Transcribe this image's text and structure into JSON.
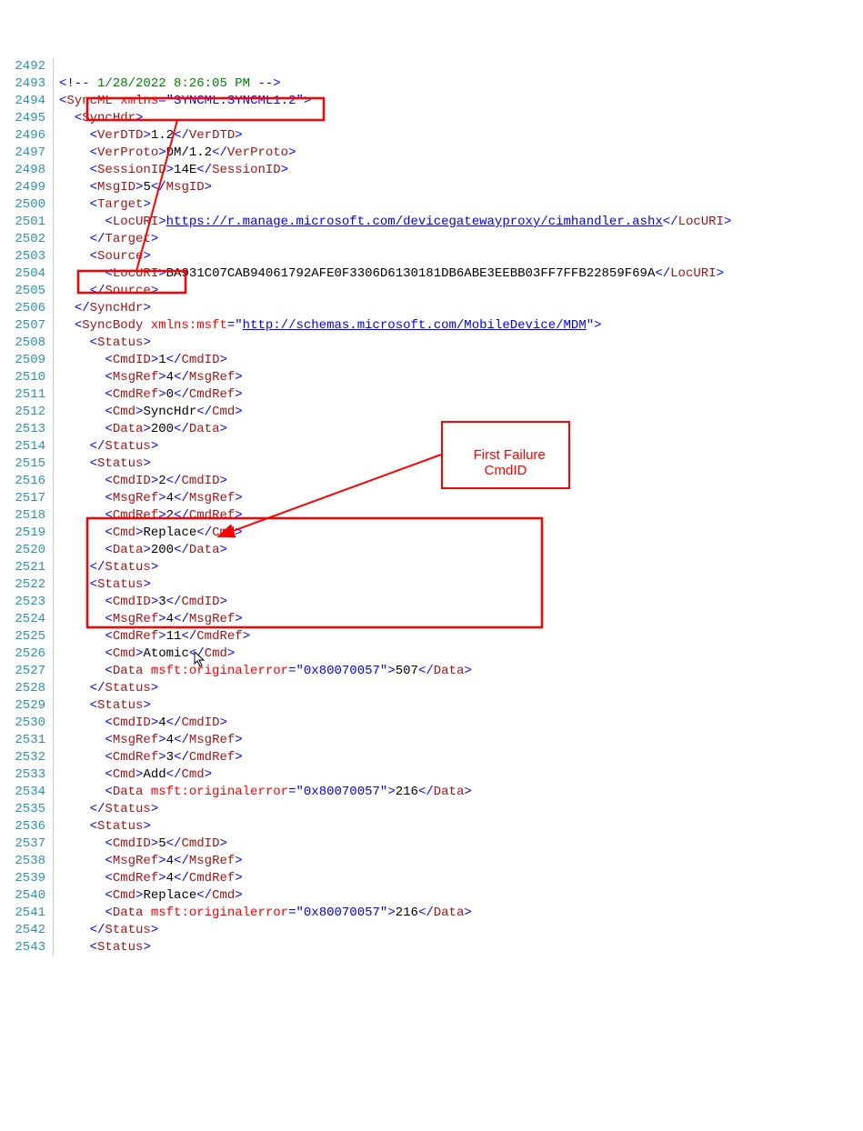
{
  "callout_label": "First Failure\nCmdID",
  "lines": [
    {
      "n": 2492,
      "html": ""
    },
    {
      "n": 2493,
      "html": "<span class='b'>&lt;!--</span> <span class='c'>1/28/2022 8:26:05 PM</span> <span class='b'>--&gt;</span>"
    },
    {
      "n": 2494,
      "html": "<span class='b'>&lt;</span><span class='t'>SyncML</span> <span class='a'>xmlns</span><span class='b'>=</span><span class='v'>\"SYNCML:SYNCML1.2\"</span><span class='b'>&gt;</span>"
    },
    {
      "n": 2495,
      "html": "  <span class='b'>&lt;</span><span class='t'>SyncHdr</span><span class='b'>&gt;</span>"
    },
    {
      "n": 2496,
      "html": "    <span class='b'>&lt;</span><span class='t'>VerDTD</span><span class='b'>&gt;</span><span class='k'>1.2</span><span class='b'>&lt;/</span><span class='t'>VerDTD</span><span class='b'>&gt;</span>"
    },
    {
      "n": 2497,
      "html": "    <span class='b'>&lt;</span><span class='t'>VerProto</span><span class='b'>&gt;</span><span class='k'>DM/1.2</span><span class='b'>&lt;/</span><span class='t'>VerProto</span><span class='b'>&gt;</span>"
    },
    {
      "n": 2498,
      "html": "    <span class='b'>&lt;</span><span class='t'>SessionID</span><span class='b'>&gt;</span><span class='k'>14E</span><span class='b'>&lt;/</span><span class='t'>SessionID</span><span class='b'>&gt;</span>"
    },
    {
      "n": 2499,
      "html": "    <span class='b'>&lt;</span><span class='t'>MsgID</span><span class='b'>&gt;</span><span class='k'>5</span><span class='b'>&lt;/</span><span class='t'>MsgID</span><span class='b'>&gt;</span>"
    },
    {
      "n": 2500,
      "html": "    <span class='b'>&lt;</span><span class='t'>Target</span><span class='b'>&gt;</span>"
    },
    {
      "n": 2501,
      "html": "      <span class='b'>&lt;</span><span class='t'>LocURI</span><span class='b'>&gt;</span><span class='u'>https://r.manage.microsoft.com/devicegatewayproxy/cimhandler.ashx</span><span class='b'>&lt;/</span><span class='t'>LocURI</span><span class='b'>&gt;</span>"
    },
    {
      "n": 2502,
      "html": "    <span class='b'>&lt;/</span><span class='t'>Target</span><span class='b'>&gt;</span>"
    },
    {
      "n": 2503,
      "html": "    <span class='b'>&lt;</span><span class='t'>Source</span><span class='b'>&gt;</span>"
    },
    {
      "n": 2504,
      "html": "      <span class='b'>&lt;</span><span class='t'>LocURI</span><span class='b'>&gt;</span><span class='k'>BA931C07CAB94061792AFE0F3306D6130181DB6ABE3EEBB03FF7FFB22859F69A</span><span class='b'>&lt;/</span><span class='t'>LocURI</span><span class='b'>&gt;</span>"
    },
    {
      "n": 2505,
      "html": "    <span class='b'>&lt;/</span><span class='t'>Source</span><span class='b'>&gt;</span>"
    },
    {
      "n": 2506,
      "html": "  <span class='b'>&lt;/</span><span class='t'>SyncHdr</span><span class='b'>&gt;</span>"
    },
    {
      "n": 2507,
      "html": "  <span class='b'>&lt;</span><span class='t'>SyncBody</span> <span class='a'>xmlns:msft</span><span class='b'>=</span><span class='b'>\"</span><span class='u'>http://schemas.microsoft.com/MobileDevice/MDM</span><span class='b'>\"&gt;</span>"
    },
    {
      "n": 2508,
      "html": "    <span class='b'>&lt;</span><span class='t'>Status</span><span class='b'>&gt;</span>"
    },
    {
      "n": 2509,
      "html": "      <span class='b'>&lt;</span><span class='t'>CmdID</span><span class='b'>&gt;</span><span class='k'>1</span><span class='b'>&lt;/</span><span class='t'>CmdID</span><span class='b'>&gt;</span>"
    },
    {
      "n": 2510,
      "html": "      <span class='b'>&lt;</span><span class='t'>MsgRef</span><span class='b'>&gt;</span><span class='k'>4</span><span class='b'>&lt;/</span><span class='t'>MsgRef</span><span class='b'>&gt;</span>"
    },
    {
      "n": 2511,
      "html": "      <span class='b'>&lt;</span><span class='t'>CmdRef</span><span class='b'>&gt;</span><span class='k'>0</span><span class='b'>&lt;/</span><span class='t'>CmdRef</span><span class='b'>&gt;</span>"
    },
    {
      "n": 2512,
      "html": "      <span class='b'>&lt;</span><span class='t'>Cmd</span><span class='b'>&gt;</span><span class='k'>SyncHdr</span><span class='b'>&lt;/</span><span class='t'>Cmd</span><span class='b'>&gt;</span>"
    },
    {
      "n": 2513,
      "html": "      <span class='b'>&lt;</span><span class='t'>Data</span><span class='b'>&gt;</span><span class='k'>200</span><span class='b'>&lt;/</span><span class='t'>Data</span><span class='b'>&gt;</span>"
    },
    {
      "n": 2514,
      "html": "    <span class='b'>&lt;/</span><span class='t'>Status</span><span class='b'>&gt;</span>"
    },
    {
      "n": 2515,
      "html": "    <span class='b'>&lt;</span><span class='t'>Status</span><span class='b'>&gt;</span>"
    },
    {
      "n": 2516,
      "html": "      <span class='b'>&lt;</span><span class='t'>CmdID</span><span class='b'>&gt;</span><span class='k'>2</span><span class='b'>&lt;/</span><span class='t'>CmdID</span><span class='b'>&gt;</span>"
    },
    {
      "n": 2517,
      "html": "      <span class='b'>&lt;</span><span class='t'>MsgRef</span><span class='b'>&gt;</span><span class='k'>4</span><span class='b'>&lt;/</span><span class='t'>MsgRef</span><span class='b'>&gt;</span>"
    },
    {
      "n": 2518,
      "html": "      <span class='b'>&lt;</span><span class='t'>CmdRef</span><span class='b'>&gt;</span><span class='k'>2</span><span class='b'>&lt;/</span><span class='t'>CmdRef</span><span class='b'>&gt;</span>"
    },
    {
      "n": 2519,
      "html": "      <span class='b'>&lt;</span><span class='t'>Cmd</span><span class='b'>&gt;</span><span class='k'>Replace</span><span class='b'>&lt;/</span><span class='t'>Cmd</span><span class='b'>&gt;</span>"
    },
    {
      "n": 2520,
      "html": "      <span class='b'>&lt;</span><span class='t'>Data</span><span class='b'>&gt;</span><span class='k'>200</span><span class='b'>&lt;/</span><span class='t'>Data</span><span class='b'>&gt;</span>"
    },
    {
      "n": 2521,
      "html": "    <span class='b'>&lt;/</span><span class='t'>Status</span><span class='b'>&gt;</span>"
    },
    {
      "n": 2522,
      "html": "    <span class='b'>&lt;</span><span class='t'>Status</span><span class='b'>&gt;</span>"
    },
    {
      "n": 2523,
      "html": "      <span class='b'>&lt;</span><span class='t'>CmdID</span><span class='b'>&gt;</span><span class='k'>3</span><span class='b'>&lt;/</span><span class='t'>CmdID</span><span class='b'>&gt;</span>"
    },
    {
      "n": 2524,
      "html": "      <span class='b'>&lt;</span><span class='t'>MsgRef</span><span class='b'>&gt;</span><span class='k'>4</span><span class='b'>&lt;/</span><span class='t'>MsgRef</span><span class='b'>&gt;</span>"
    },
    {
      "n": 2525,
      "html": "      <span class='b'>&lt;</span><span class='t'>CmdRef</span><span class='b'>&gt;</span><span class='k'>11</span><span class='b'>&lt;/</span><span class='t'>CmdRef</span><span class='b'>&gt;</span>"
    },
    {
      "n": 2526,
      "html": "      <span class='b'>&lt;</span><span class='t'>Cmd</span><span class='b'>&gt;</span><span class='k'>Atomic</span><span class='b'>&lt;/</span><span class='t'>Cmd</span><span class='b'>&gt;</span>"
    },
    {
      "n": 2527,
      "html": "      <span class='b'>&lt;</span><span class='t'>Data</span> <span class='a'>msft:originalerror</span><span class='b'>=</span><span class='v'>\"0x80070057\"</span><span class='b'>&gt;</span><span class='k'>507</span><span class='b'>&lt;/</span><span class='t'>Data</span><span class='b'>&gt;</span>"
    },
    {
      "n": 2528,
      "html": "    <span class='b'>&lt;/</span><span class='t'>Status</span><span class='b'>&gt;</span>"
    },
    {
      "n": 2529,
      "html": "    <span class='b'>&lt;</span><span class='t'>Status</span><span class='b'>&gt;</span>"
    },
    {
      "n": 2530,
      "html": "      <span class='b'>&lt;</span><span class='t'>CmdID</span><span class='b'>&gt;</span><span class='k'>4</span><span class='b'>&lt;/</span><span class='t'>CmdID</span><span class='b'>&gt;</span>"
    },
    {
      "n": 2531,
      "html": "      <span class='b'>&lt;</span><span class='t'>MsgRef</span><span class='b'>&gt;</span><span class='k'>4</span><span class='b'>&lt;/</span><span class='t'>MsgRef</span><span class='b'>&gt;</span>"
    },
    {
      "n": 2532,
      "html": "      <span class='b'>&lt;</span><span class='t'>CmdRef</span><span class='b'>&gt;</span><span class='k'>3</span><span class='b'>&lt;/</span><span class='t'>CmdRef</span><span class='b'>&gt;</span>"
    },
    {
      "n": 2533,
      "html": "      <span class='b'>&lt;</span><span class='t'>Cmd</span><span class='b'>&gt;</span><span class='k'>Add</span><span class='b'>&lt;/</span><span class='t'>Cmd</span><span class='b'>&gt;</span>"
    },
    {
      "n": 2534,
      "html": "      <span class='b'>&lt;</span><span class='t'>Data</span> <span class='a'>msft:originalerror</span><span class='b'>=</span><span class='v'>\"0x80070057\"</span><span class='b'>&gt;</span><span class='k'>216</span><span class='b'>&lt;/</span><span class='t'>Data</span><span class='b'>&gt;</span>"
    },
    {
      "n": 2535,
      "html": "    <span class='b'>&lt;/</span><span class='t'>Status</span><span class='b'>&gt;</span>"
    },
    {
      "n": 2536,
      "html": "    <span class='b'>&lt;</span><span class='t'>Status</span><span class='b'>&gt;</span>"
    },
    {
      "n": 2537,
      "html": "      <span class='b'>&lt;</span><span class='t'>CmdID</span><span class='b'>&gt;</span><span class='k'>5</span><span class='b'>&lt;/</span><span class='t'>CmdID</span><span class='b'>&gt;</span>"
    },
    {
      "n": 2538,
      "html": "      <span class='b'>&lt;</span><span class='t'>MsgRef</span><span class='b'>&gt;</span><span class='k'>4</span><span class='b'>&lt;/</span><span class='t'>MsgRef</span><span class='b'>&gt;</span>"
    },
    {
      "n": 2539,
      "html": "      <span class='b'>&lt;</span><span class='t'>CmdRef</span><span class='b'>&gt;</span><span class='k'>4</span><span class='b'>&lt;/</span><span class='t'>CmdRef</span><span class='b'>&gt;</span>"
    },
    {
      "n": 2540,
      "html": "      <span class='b'>&lt;</span><span class='t'>Cmd</span><span class='b'>&gt;</span><span class='k'>Replace</span><span class='b'>&lt;/</span><span class='t'>Cmd</span><span class='b'>&gt;</span>"
    },
    {
      "n": 2541,
      "html": "      <span class='b'>&lt;</span><span class='t'>Data</span> <span class='a'>msft:originalerror</span><span class='b'>=</span><span class='v'>\"0x80070057\"</span><span class='b'>&gt;</span><span class='k'>216</span><span class='b'>&lt;/</span><span class='t'>Data</span><span class='b'>&gt;</span>"
    },
    {
      "n": 2542,
      "html": "    <span class='b'>&lt;/</span><span class='t'>Status</span><span class='b'>&gt;</span>"
    },
    {
      "n": 2543,
      "html": "    <span class='b'>&lt;</span><span class='t'>Status</span><span class='b'>&gt;</span>"
    }
  ]
}
